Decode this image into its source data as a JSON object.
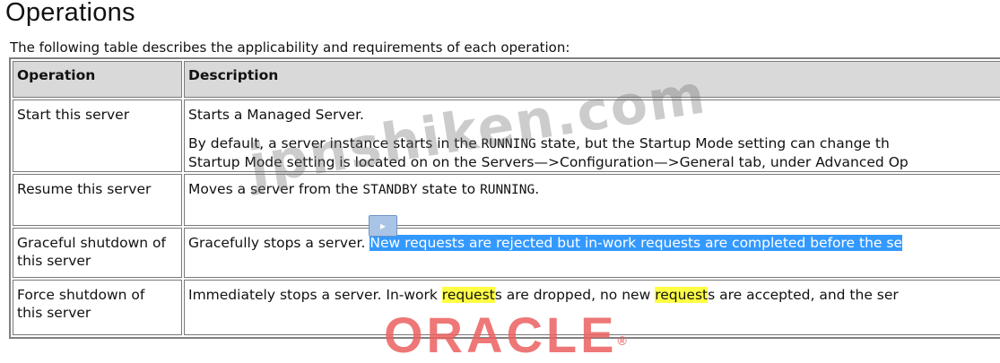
{
  "page": {
    "heading": "Operations",
    "intro": "The following table describes the applicability and requirements of each operation:"
  },
  "table": {
    "headers": {
      "operation": "Operation",
      "description": "Description"
    },
    "rows": [
      {
        "operation": "Start this server",
        "desc_line1": "Starts a Managed Server.",
        "desc_p2a": "By default, a server instance starts in the ",
        "desc_p2b": "RUNNING",
        "desc_p2c": " state, but the Startup Mode setting can change th",
        "desc_p3": "Startup Mode setting is located on on the Servers—>Configuration—>General tab, under Advanced Op"
      },
      {
        "operation": "Resume this server",
        "desc_a": "Moves a server from the ",
        "desc_b": "STANDBY",
        "desc_c": " state to ",
        "desc_d": "RUNNING",
        "desc_e": "."
      },
      {
        "operation_line1": "Graceful shutdown of",
        "operation_line2": "this server",
        "desc_a": "Gracefully stops a server. ",
        "desc_selected": "New requests are rejected but in-work requests are completed before the se"
      },
      {
        "operation_line1": "Force shutdown of",
        "operation_line2": "this server",
        "desc_a": "Immediately stops a server. In-work ",
        "desc_hl1": "request",
        "desc_b": "s are dropped, no new ",
        "desc_hl2": "request",
        "desc_c": "s are accepted, and the ser"
      }
    ]
  },
  "overlays": {
    "watermark": "jpnshiken.com",
    "brand": "ORACLE",
    "brand_mark": "®"
  },
  "colors": {
    "selection": "#3399ff",
    "highlight": "#ffff44",
    "header_bg": "#d9d9d9",
    "brand": "#eb5f5f"
  }
}
